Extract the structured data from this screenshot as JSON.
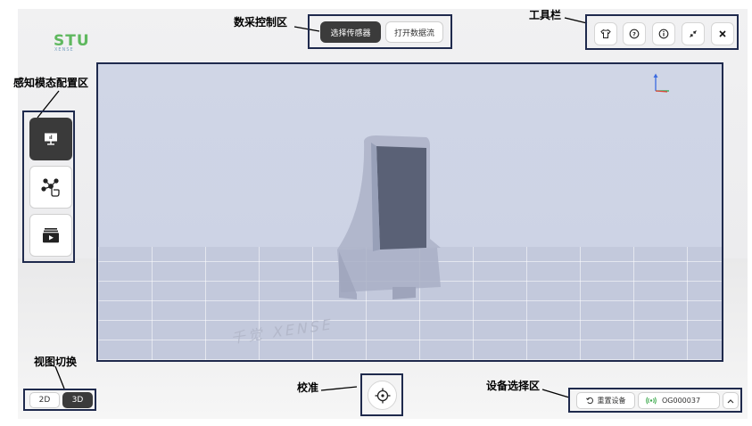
{
  "logo": {
    "main": "STU",
    "sub": "XENSE"
  },
  "annotations": {
    "data_control": "数采控制区",
    "toolbar": "工具栏",
    "perception": "感知模态配置区",
    "view_switch": "视图切换",
    "calibrate": "校准",
    "device_select": "设备选择区"
  },
  "data_control": {
    "select_sensor": "选择传感器",
    "open_stream": "打开数据流"
  },
  "toolbar": {
    "icons": [
      "shirt-icon",
      "help-icon",
      "info-icon",
      "collapse-icon",
      "close-icon"
    ]
  },
  "perception_modes": [
    "depth-map-icon",
    "network-touch-icon",
    "video-icon"
  ],
  "viewport": {
    "floor_watermark": "千觉 XENSE"
  },
  "view_switch": {
    "options": [
      "2D",
      "3D"
    ],
    "active": "3D"
  },
  "device": {
    "reset_label": "重置设备",
    "device_id": "OG000037"
  },
  "colors": {
    "annotation_border": "#1f2a4d",
    "dark_button": "#3b3b3b",
    "axis_x": "#e0453a",
    "axis_y": "#3b6be0",
    "axis_z": "#2ea84f"
  }
}
